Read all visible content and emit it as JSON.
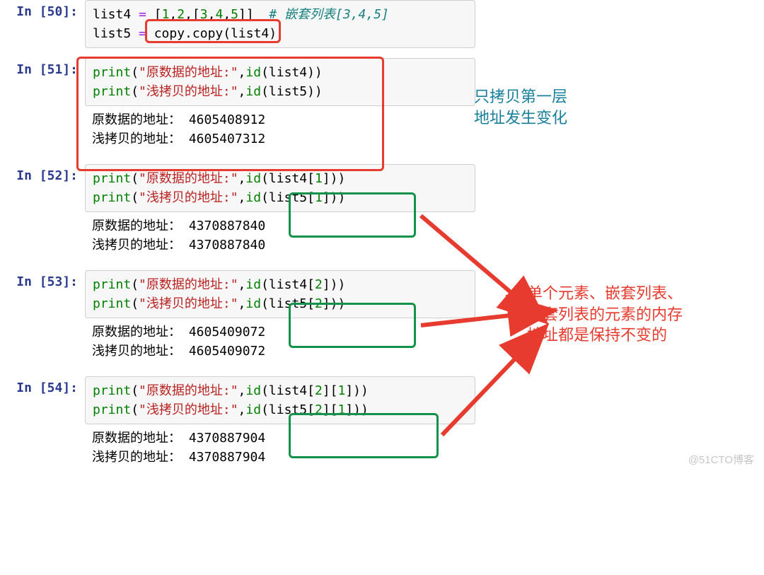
{
  "prompts": {
    "c50": "In [50]:",
    "c51": "In [51]:",
    "c52": "In [52]:",
    "c53": "In [53]:",
    "c54": "In [54]:"
  },
  "code": {
    "c50_l1_a": "list4 ",
    "c50_l1_op": "=",
    "c50_l1_b": " [",
    "c50_l1_n1": "1",
    "c50_l1_c": ",",
    "c50_l1_n2": "2",
    "c50_l1_d": ",[",
    "c50_l1_n3": "3",
    "c50_l1_e": ",",
    "c50_l1_n4": "4",
    "c50_l1_f": ",",
    "c50_l1_n5": "5",
    "c50_l1_g": "]]  ",
    "c50_l1_cmt": "# 嵌套列表[3,4,5]",
    "c50_l2_a": "list5 ",
    "c50_l2_op": "=",
    "c50_l2_b": " copy.copy(list4)",
    "c51_l1_fn": "print",
    "c51_l1_p1": "(",
    "c51_l1_s": "\"原数据的地址:\"",
    "c51_l1_c": ",",
    "c51_l1_id": "id",
    "c51_l1_rest": "(list4))",
    "c51_l2_s": "\"浅拷贝的地址:\"",
    "c51_l2_rest": "(list5))",
    "c52_l1_rest": "(list4[",
    "c52_idx": "1",
    "c52_close": "]))",
    "c52_l2_rest": "(list5[",
    "c53_l1_rest": "(list4[",
    "c53_idx": "2",
    "c53_close": "]))",
    "c53_l2_rest": "(list5[",
    "c54_l1_rest": "(list4[",
    "c54_i1": "2",
    "c54_mid": "][",
    "c54_i2": "1",
    "c54_close": "]))",
    "c54_l2_rest": "(list5["
  },
  "output": {
    "c51_l1": "原数据的地址： 4605408912",
    "c51_l2": "浅拷贝的地址： 4605407312",
    "c52_l1": "原数据的地址： 4370887840",
    "c52_l2": "浅拷贝的地址： 4370887840",
    "c53_l1": "原数据的地址： 4605409072",
    "c53_l2": "浅拷贝的地址： 4605409072",
    "c54_l1": "原数据的地址： 4370887904",
    "c54_l2": "浅拷贝的地址： 4370887904"
  },
  "annotations": {
    "teal_l1": "只拷贝第一层",
    "teal_l2": "地址发生变化",
    "red_l1": "单个元素、嵌套列表、",
    "red_l2": "嵌套列表的元素的内存",
    "red_l3": "地址都是保持不变的"
  },
  "watermark": "@51CTO博客"
}
